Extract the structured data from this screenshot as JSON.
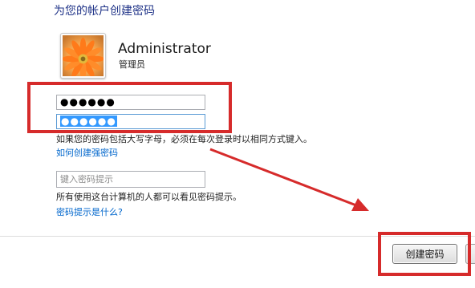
{
  "page": {
    "title": "为您的帐户创建密码"
  },
  "account": {
    "username": "Administrator",
    "role": "管理员",
    "avatar_icon": "flower-avatar-icon"
  },
  "password": {
    "new_value": "●●●●●●",
    "confirm_value": "●●●●●●"
  },
  "notes": {
    "case_warning": "如果您的密码包括大写字母，必须在每次登录时以相同方式键入。",
    "strong_password_link": "如何创建强密码",
    "hint_placeholder": "键入密码提示",
    "hint_visibility": "所有使用这台计算机的人都可以看见密码提示。",
    "what_is_hint_link": "密码提示是什么?"
  },
  "actions": {
    "create_label": "创建密码"
  },
  "colors": {
    "title": "#1e3287",
    "link": "#0066cc",
    "annotation_red": "#d62b2b",
    "selection": "#3399ff"
  }
}
